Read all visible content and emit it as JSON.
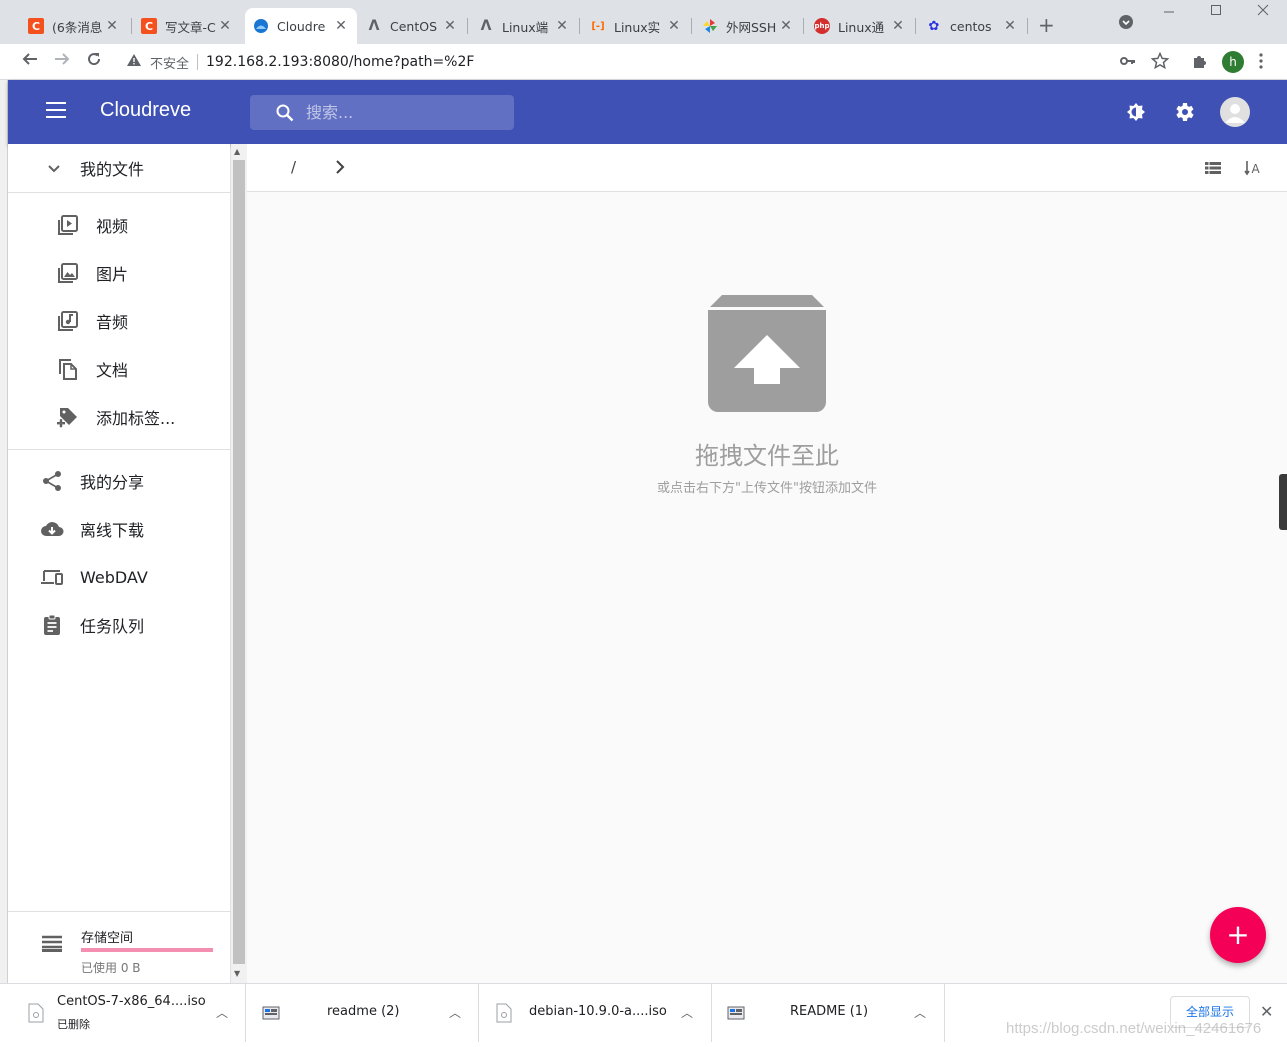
{
  "browser": {
    "tabs": [
      {
        "title": "(6条消息",
        "icon_color": "#f4511e",
        "icon_text": "C"
      },
      {
        "title": "写文章-C",
        "icon_color": "#f4511e",
        "icon_text": "C"
      },
      {
        "title": "Cloudre",
        "icon_color": "#1976d2",
        "icon_text": ""
      },
      {
        "title": "CentOS",
        "icon_color": "#5f6368",
        "icon_text": "ꭒ"
      },
      {
        "title": "Linux端",
        "icon_color": "#5f6368",
        "icon_text": "ꭒ"
      },
      {
        "title": "Linux实",
        "icon_color": "#ff6a00",
        "icon_text": "[-]"
      },
      {
        "title": "外网SSH",
        "icon_color": "#e53935",
        "icon_text": "✦"
      },
      {
        "title": "Linux通",
        "icon_color": "#d32f2f",
        "icon_text": "php"
      },
      {
        "title": "centos",
        "icon_color": "#2932e1",
        "icon_text": "✿"
      }
    ],
    "close_glyph": "✕",
    "new_tab": "+",
    "insecure_label": "不安全",
    "url": "192.168.2.193:8080/home?path=%2F",
    "profile_initial": "h"
  },
  "app": {
    "name": "Cloudreve",
    "search_placeholder": "搜索...",
    "theme_color": "#3f51b5",
    "accent_color": "#f50057"
  },
  "sidebar": {
    "my_files": "我的文件",
    "sub_items": [
      {
        "label": "视频",
        "icon": "video-library-icon"
      },
      {
        "label": "图片",
        "icon": "photo-library-icon"
      },
      {
        "label": "音频",
        "icon": "library-music-icon"
      },
      {
        "label": "文档",
        "icon": "file-copy-icon"
      },
      {
        "label": "添加标签...",
        "icon": "add-tag-icon"
      }
    ],
    "items": [
      {
        "label": "我的分享",
        "icon": "share-icon"
      },
      {
        "label": "离线下载",
        "icon": "cloud-download-icon"
      },
      {
        "label": "WebDAV",
        "icon": "devices-icon"
      },
      {
        "label": "任务队列",
        "icon": "assignment-icon"
      }
    ],
    "storage": {
      "title": "存储空间",
      "used": "已使用 0 B"
    }
  },
  "main": {
    "breadcrumb_root": "/",
    "empty_title": "拖拽文件至此",
    "empty_subtitle": "或点击右下方\"上传文件\"按钮添加文件",
    "fab_label": "+"
  },
  "downloads": {
    "items": [
      {
        "name": "CentOS-7-x86_64....iso",
        "status": "已删除"
      },
      {
        "name": "readme (2)",
        "status": ""
      },
      {
        "name": "debian-10.9.0-a....iso",
        "status": ""
      },
      {
        "name": "README (1)",
        "status": ""
      }
    ],
    "show_all": "全部显示",
    "close": "✕"
  },
  "watermark": "https://blog.csdn.net/weixin_42461676"
}
